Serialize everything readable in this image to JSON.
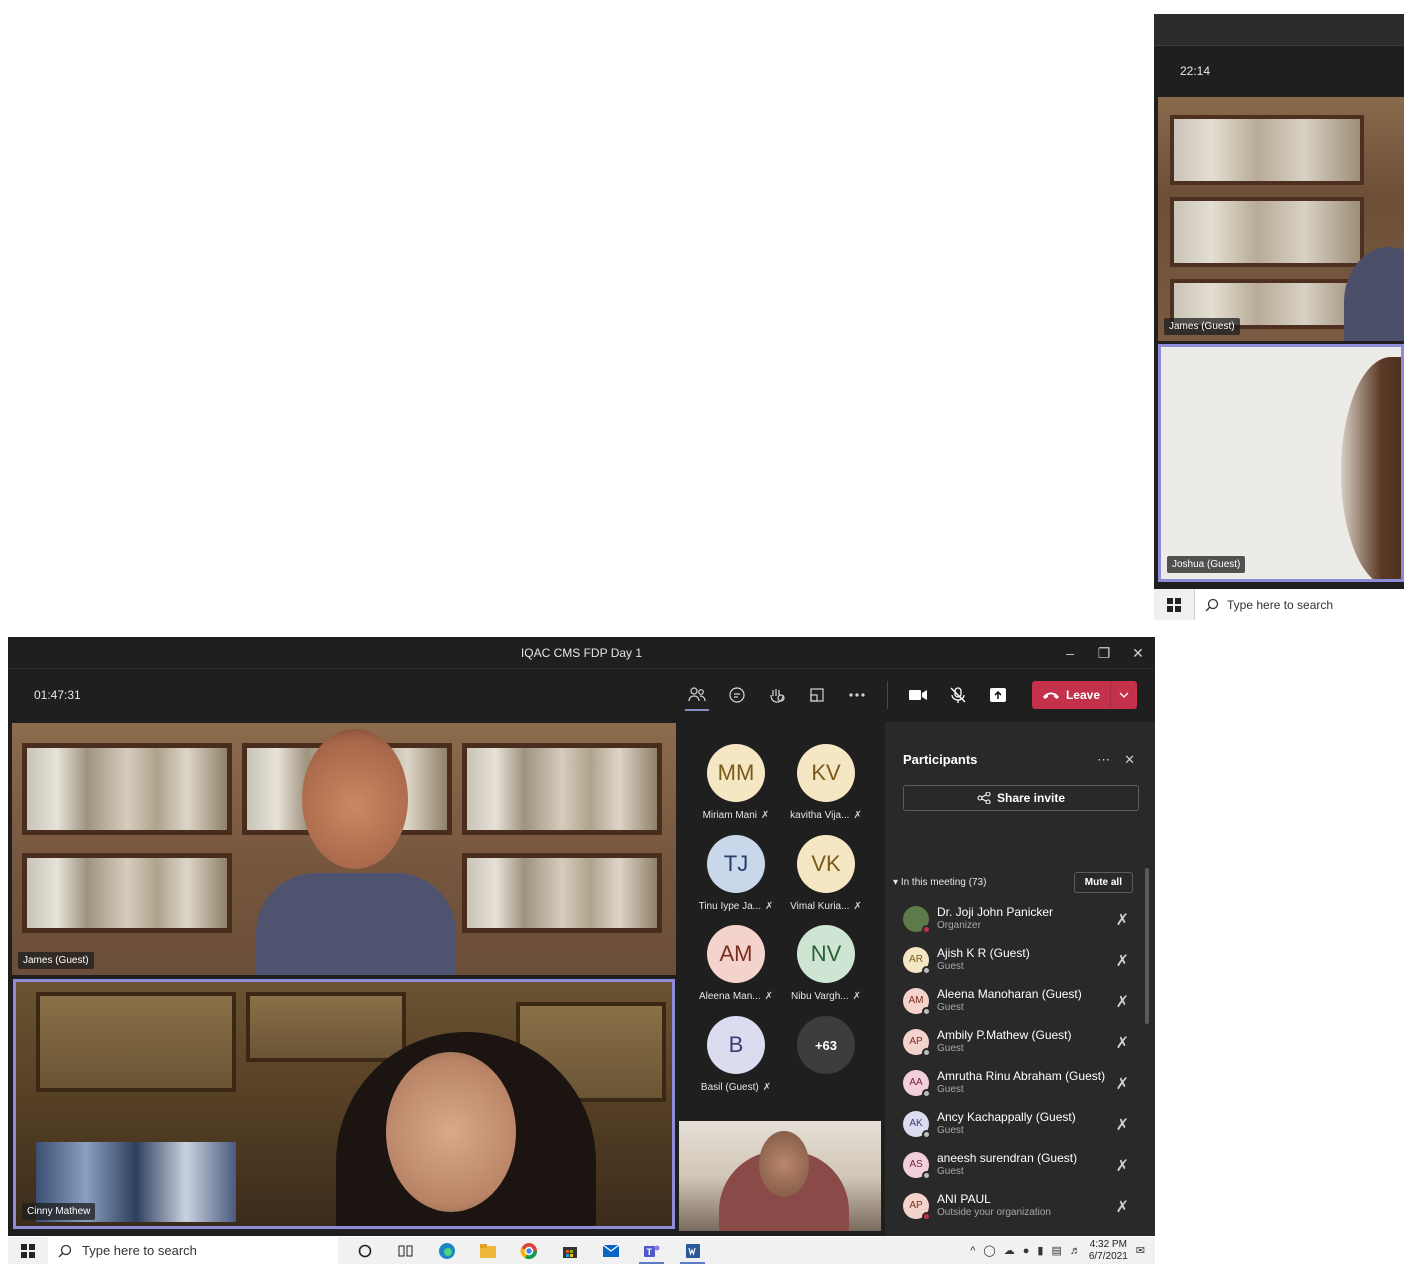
{
  "mini_window": {
    "timer": "22:14",
    "tiles": [
      {
        "name": "James (Guest)"
      },
      {
        "name": "Joshua (Guest)"
      }
    ],
    "search_placeholder": "Type here to search"
  },
  "window": {
    "title": "IQAC CMS FDP Day 1",
    "controls": [
      "minimize-icon",
      "restore-icon",
      "close-icon"
    ]
  },
  "meeting": {
    "timer": "01:47:31",
    "leave_label": "Leave",
    "toolbar_icons": [
      "people-icon",
      "chat-icon",
      "reactions-icon",
      "rooms-icon",
      "more-icon",
      "camera-icon",
      "mic-muted-icon",
      "share-tray-icon"
    ]
  },
  "videos": [
    {
      "name": "James (Guest)"
    },
    {
      "name": "Cinny Mathew"
    }
  ],
  "grid": [
    {
      "initials": "MM",
      "name": "Miriam Mani",
      "bg": "#f6e7c4",
      "fg": "#7a5a17"
    },
    {
      "initials": "KV",
      "name": "kavitha Vija...",
      "bg": "#f6e7c4",
      "fg": "#7a5a17"
    },
    {
      "initials": "TJ",
      "name": "Tinu Iype Ja...",
      "bg": "#c9d7ea",
      "fg": "#24406b"
    },
    {
      "initials": "VK",
      "name": "Vimal Kuria...",
      "bg": "#f6e7c4",
      "fg": "#7a5a17"
    },
    {
      "initials": "AM",
      "name": "Aleena Man...",
      "bg": "#f4d3cc",
      "fg": "#7a2e1e"
    },
    {
      "initials": "NV",
      "name": "Nibu Vargh...",
      "bg": "#cfe5d4",
      "fg": "#2b5f37"
    },
    {
      "initials": "B",
      "name": "Basil (Guest)",
      "bg": "#dcdcf1",
      "fg": "#3c3c72"
    },
    {
      "initials": "+63",
      "name": "",
      "bg": "#3d3d3d",
      "fg": "#ffffff"
    }
  ],
  "participants": {
    "title": "Participants",
    "share_invite": "Share invite",
    "section_label": "In this meeting (73)",
    "mute_all": "Mute all",
    "list": [
      {
        "initials": "",
        "name": "Dr. Joji John Panicker",
        "role": "Organizer",
        "bg": "#5d7a4a",
        "fg": "#ffffff",
        "status": "#c4314b"
      },
      {
        "initials": "AR",
        "name": "Ajish K R (Guest)",
        "role": "Guest",
        "bg": "#f6e7c4",
        "fg": "#7a5a17",
        "status": "#bdbdbd"
      },
      {
        "initials": "AM",
        "name": "Aleena Manoharan (Guest)",
        "role": "Guest",
        "bg": "#f4d3cc",
        "fg": "#7a2e1e",
        "status": "#bdbdbd"
      },
      {
        "initials": "AP",
        "name": "Ambily P.Mathew (Guest)",
        "role": "Guest",
        "bg": "#f4d3cc",
        "fg": "#7a2e1e",
        "status": "#bdbdbd"
      },
      {
        "initials": "AA",
        "name": "Amrutha Rinu Abraham (Guest)",
        "role": "Guest",
        "bg": "#f1d0dc",
        "fg": "#7a1e46",
        "status": "#bdbdbd"
      },
      {
        "initials": "AK",
        "name": "Ancy Kachappally (Guest)",
        "role": "Guest",
        "bg": "#dcdcf1",
        "fg": "#3c3c72",
        "status": "#bdbdbd"
      },
      {
        "initials": "AS",
        "name": "aneesh surendran (Guest)",
        "role": "Guest",
        "bg": "#f1d0dc",
        "fg": "#7a1e46",
        "status": "#bdbdbd"
      },
      {
        "initials": "AP",
        "name": "ANI PAUL",
        "role": "Outside your organization",
        "bg": "#f4d3cc",
        "fg": "#7a2e1e",
        "status": "#c4314b"
      }
    ]
  },
  "taskbar": {
    "search_placeholder": "Type here to search",
    "time": "4:32 PM",
    "date": "6/7/2021",
    "apps": [
      "cortana-icon",
      "task-view-icon",
      "edge-icon",
      "file-explorer-icon",
      "chrome-icon",
      "store-icon",
      "mail-icon",
      "teams-icon",
      "word-icon"
    ]
  }
}
